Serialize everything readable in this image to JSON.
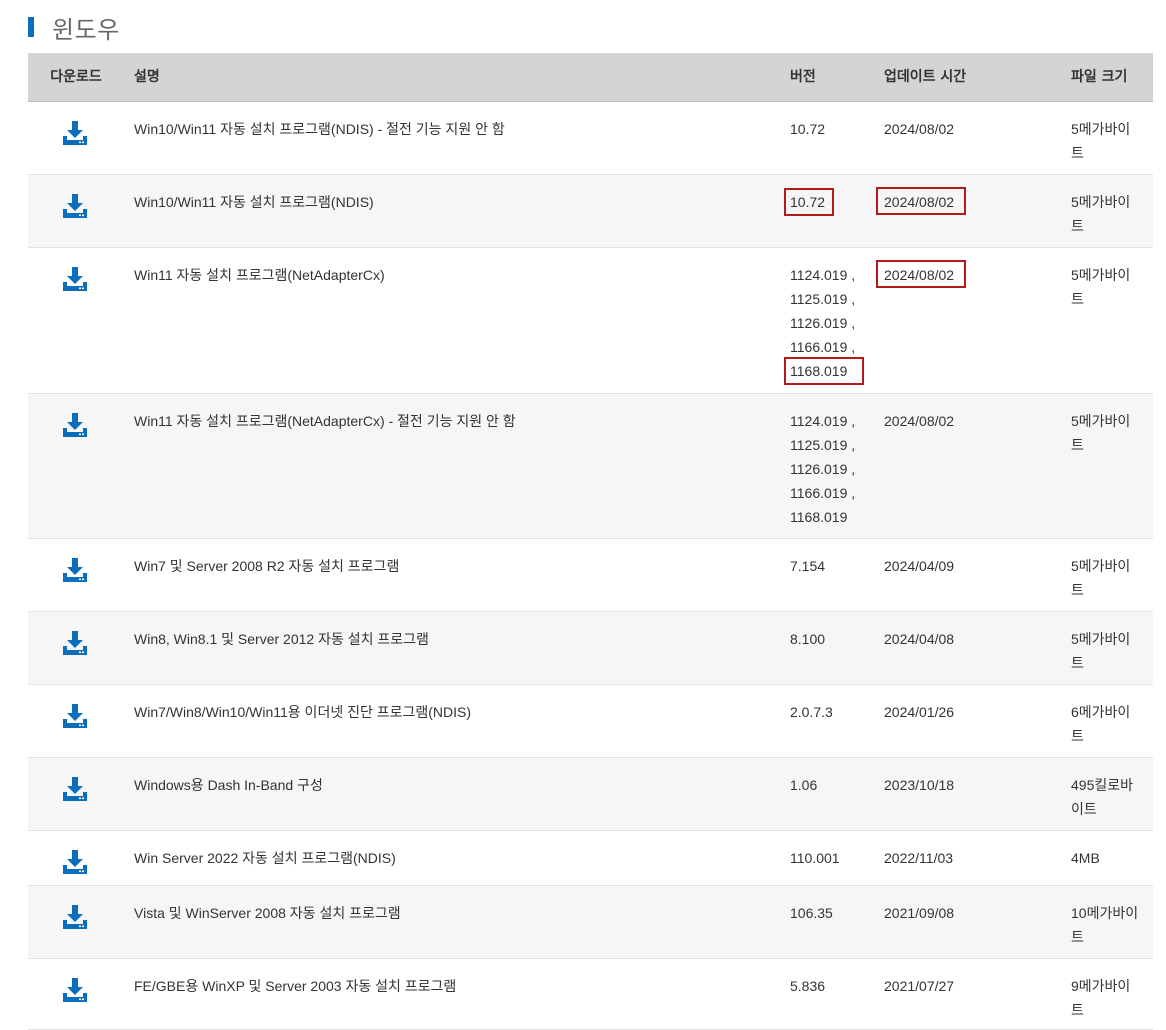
{
  "section": {
    "title": "윈도우"
  },
  "colors": {
    "accent": "#0a6ebd",
    "highlight": "#b11b1b",
    "header_bg": "#d4d4d4"
  },
  "table": {
    "headers": {
      "download": "다운로드",
      "description": "설명",
      "version": "버전",
      "updated": "업데이트 시간",
      "size": "파일 크기"
    },
    "rows": [
      {
        "description": "Win10/Win11 자동 설치 프로그램(NDIS) - 절전 기능 지원 안 함",
        "versions": [
          "10.72"
        ],
        "date": "2024/08/02",
        "size": "5메가바이트"
      },
      {
        "description": "Win10/Win11 자동 설치 프로그램(NDIS)",
        "versions": [
          "10.72"
        ],
        "date": "2024/08/02",
        "size": "5메가바이트",
        "highlight_version_index": 0,
        "highlight_date": true
      },
      {
        "description": "Win11 자동 설치 프로그램(NetAdapterCx)",
        "versions": [
          "1124.019 ,",
          "1125.019 ,",
          "1126.019 ,",
          "1166.019 ,",
          "1168.019"
        ],
        "date": "2024/08/02",
        "size": "5메가바이트",
        "highlight_version_index": 4,
        "highlight_date": true
      },
      {
        "description": "Win11 자동 설치 프로그램(NetAdapterCx) - 절전 기능 지원 안 함",
        "versions": [
          "1124.019 ,",
          "1125.019 ,",
          "1126.019 ,",
          "1166.019 ,",
          "1168.019"
        ],
        "date": "2024/08/02",
        "size": "5메가바이트"
      },
      {
        "description": "Win7 및 Server 2008 R2 자동 설치 프로그램",
        "versions": [
          "7.154"
        ],
        "date": "2024/04/09",
        "size": "5메가바이트"
      },
      {
        "description": "Win8, Win8.1 및 Server 2012 자동 설치 프로그램",
        "versions": [
          "8.100"
        ],
        "date": "2024/04/08",
        "size": "5메가바이트"
      },
      {
        "description": "Win7/Win8/Win10/Win11용 이더넷 진단 프로그램(NDIS)",
        "versions": [
          "2.0.7.3"
        ],
        "date": "2024/01/26",
        "size": "6메가바이트"
      },
      {
        "description": "Windows용 Dash In-Band 구성",
        "versions": [
          "1.06"
        ],
        "date": "2023/10/18",
        "size": "495킬로바이트"
      },
      {
        "description": "Win Server 2022 자동 설치 프로그램(NDIS)",
        "versions": [
          "110.001"
        ],
        "date": "2022/11/03",
        "size": "4MB"
      },
      {
        "description": "Vista 및 WinServer 2008 자동 설치 프로그램",
        "versions": [
          "106.35"
        ],
        "date": "2021/09/08",
        "size": "10메가바이트"
      },
      {
        "description": "FE/GBE용 WinXP 및 Server 2003 자동 설치 프로그램",
        "versions": [
          "5.836"
        ],
        "date": "2021/07/27",
        "size": "9메가바이트"
      }
    ]
  }
}
